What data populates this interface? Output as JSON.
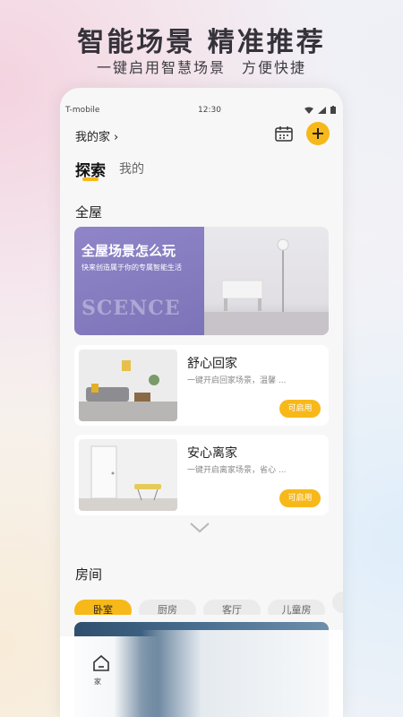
{
  "promo": {
    "title": "智能场景 精准推荐",
    "subtitle": "一键启用智慧场景　方便快捷"
  },
  "status_bar": {
    "carrier": "T-mobile",
    "time": "12:30"
  },
  "header": {
    "home_name": "我的家",
    "home_chevron": "›"
  },
  "tabs": [
    {
      "label": "探索",
      "active": true
    },
    {
      "label": "我的",
      "active": false
    }
  ],
  "whole_house": {
    "title": "全屋",
    "banner": {
      "title": "全屋场景怎么玩",
      "subtitle": "快来创造属于你的专属智能生活",
      "watermark": "SCENCE"
    },
    "scenes": [
      {
        "name": "舒心回家",
        "description": "一键开启回家场景，温馨 ...",
        "button": "可启用"
      },
      {
        "name": "安心离家",
        "description": "一键开启离家场景，省心 ...",
        "button": "可启用"
      }
    ]
  },
  "rooms": {
    "title": "房间",
    "chips": [
      "卧室",
      "厨房",
      "客厅",
      "儿童房",
      ""
    ],
    "active_index": 0
  },
  "bottom_nav": {
    "home_label": "家"
  },
  "colors": {
    "accent": "#f7b81a",
    "banner_purple": "#8f85c8"
  }
}
